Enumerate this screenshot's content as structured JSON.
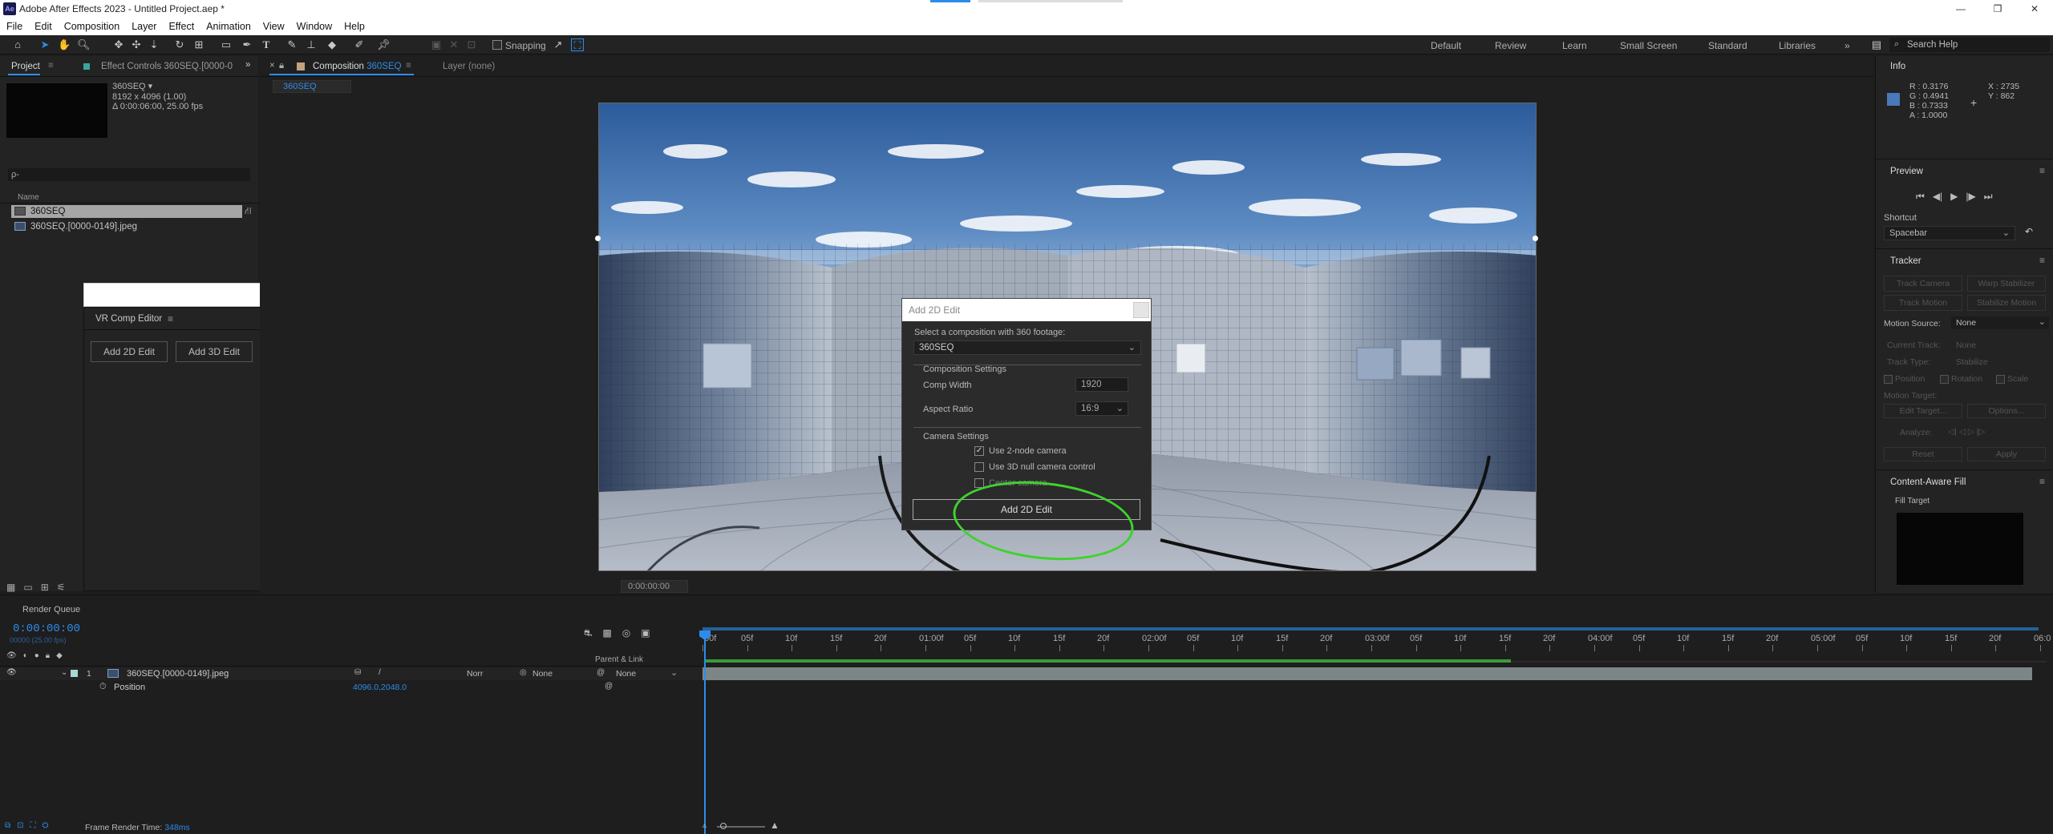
{
  "app": {
    "title": "Adobe After Effects 2023 - Untitled Project.aep *",
    "logo": "Ae"
  },
  "menu": [
    "File",
    "Edit",
    "Composition",
    "Layer",
    "Effect",
    "Animation",
    "View",
    "Window",
    "Help"
  ],
  "toolbar": {
    "snapping_label": "Snapping",
    "workspaces": [
      "Default",
      "Review",
      "Learn",
      "Small Screen",
      "Standard",
      "Libraries"
    ],
    "search_placeholder": "Search Help"
  },
  "project": {
    "tab_project": "Project",
    "tab_effect_controls": "Effect Controls 360SEQ.[0000-0",
    "item_name": "360SEQ",
    "item_dims": "8192 x 4096 (1.00)",
    "item_duration": "Δ 0:00:06:00, 25.00 fps",
    "search_prefix": "ρ-",
    "col_name": "Name",
    "items": [
      "360SEQ",
      "360SEQ.[0000-0149].jpeg"
    ]
  },
  "vr_editor": {
    "title": "VR Comp Editor",
    "add2d": "Add 2D Edit",
    "add3d": "Add 3D Edit"
  },
  "composition": {
    "tab_label": "Composition",
    "tab_name": "360SEQ",
    "layer_tab": "Layer (none)",
    "breadcrumb": "360SEQ",
    "timecode": "0:00:00:00"
  },
  "dialog": {
    "title": "Add 2D Edit",
    "select_label": "Select a composition with 360 footage:",
    "select_value": "360SEQ",
    "comp_settings": "Composition Settings",
    "comp_width_label": "Comp Width",
    "comp_width_value": "1920",
    "aspect_label": "Aspect Ratio",
    "aspect_value": "16:9",
    "camera_settings": "Camera Settings",
    "opt1": "Use 2-node camera",
    "opt2": "Use 3D null camera control",
    "opt3": "Center camera",
    "opt1_checked": true,
    "opt2_checked": false,
    "opt3_checked": false,
    "button": "Add 2D Edit"
  },
  "info": {
    "title": "Info",
    "r": "R : 0.3176",
    "g": "G : 0.4941",
    "b": "B : 0.7333",
    "a": "A : 1.0000",
    "x": "X : 2735",
    "y": "Y : 862",
    "swatch": "#4a78b8"
  },
  "preview": {
    "title": "Preview",
    "shortcut_label": "Shortcut",
    "shortcut_value": "Spacebar"
  },
  "tracker": {
    "title": "Tracker",
    "track_camera": "Track Camera",
    "warp_stabilizer": "Warp Stabilizer",
    "track_motion": "Track Motion",
    "stabilize_motion": "Stabilize Motion",
    "motion_source_label": "Motion Source:",
    "motion_source_value": "None",
    "current_track_label": "Current Track:",
    "current_track_value": "None",
    "track_type_label": "Track Type:",
    "track_type_value": "Stabilize",
    "position": "Position",
    "rotation": "Rotation",
    "scale": "Scale",
    "motion_target": "Motion Target:",
    "edit_target": "Edit Target...",
    "options": "Options...",
    "analyze": "Analyze:",
    "reset": "Reset",
    "apply": "Apply"
  },
  "caf": {
    "title": "Content-Aware Fill",
    "fill_target": "Fill Target"
  },
  "timeline": {
    "render_queue": "Render Queue",
    "timecode": "0:00:00:00",
    "fps": "00000 (25.00 fps)",
    "parent_link": "Parent & Link",
    "layer_num": "1",
    "layer_name": "360SEQ.[0000-0149].jpeg",
    "mode1": "Norr",
    "mode2": "None",
    "parent_value": "None",
    "position_label": "Position",
    "position_value": "4096.0,2048.0",
    "ruler_labels": [
      "00f",
      "05f",
      "10f",
      "15f",
      "20f",
      "01:00f",
      "05f",
      "10f",
      "15f",
      "20f",
      "02:00f",
      "05f",
      "10f",
      "15f",
      "20f",
      "03:00f",
      "05f",
      "10f",
      "15f",
      "20f",
      "04:00f",
      "05f",
      "10f",
      "15f",
      "20f",
      "05:00f",
      "05f",
      "10f",
      "15f",
      "20f",
      "06:0"
    ],
    "frame_render_label": "Frame Render Time:",
    "frame_render_value": "348ms"
  },
  "colors": {
    "accent": "#2d8ceb",
    "highlight_circle": "#3ed22e",
    "work_area": "#3b9b3b"
  }
}
